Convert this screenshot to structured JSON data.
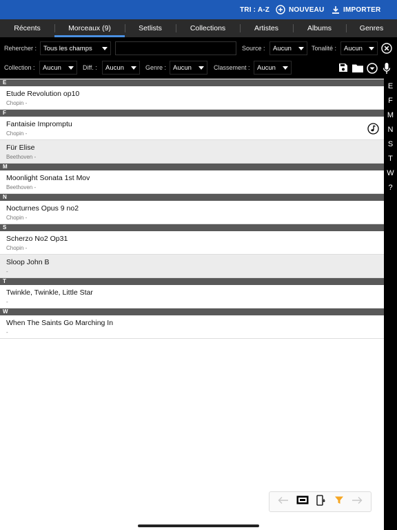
{
  "topbar": {
    "sort_label": "TRI : A-Z",
    "new_label": "NOUVEAU",
    "import_label": "IMPORTER",
    "bg_color": "#1e5bb8"
  },
  "tabs": [
    {
      "label": "Récents",
      "active": false
    },
    {
      "label": "Morceaux (9)",
      "active": true
    },
    {
      "label": "Setlists",
      "active": false
    },
    {
      "label": "Collections",
      "active": false
    },
    {
      "label": "Artistes",
      "active": false
    },
    {
      "label": "Albums",
      "active": false
    },
    {
      "label": "Genres",
      "active": false
    }
  ],
  "filters": {
    "search_label": "Rehercher :",
    "search_scope": "Tous les champs",
    "search_value": "",
    "source_label": "Source :",
    "source_value": "Aucun",
    "key_label": "Tonalité :",
    "key_value": "Aucun",
    "collection_label": "Collection :",
    "collection_value": "Aucun",
    "difficulty_label": "Diff. :",
    "difficulty_value": "Aucun",
    "genre_label": "Genre :",
    "genre_value": "Aucun",
    "rating_label": "Classement :",
    "rating_value": "Aucun"
  },
  "sections": [
    {
      "letter": "E",
      "items": [
        {
          "title": "Etude Revolution op10",
          "subtitle": "Chopin -",
          "alt": false,
          "note": false
        }
      ]
    },
    {
      "letter": "F",
      "items": [
        {
          "title": "Fantaisie Impromptu",
          "subtitle": "Chopin -",
          "alt": false,
          "note": true
        },
        {
          "title": "Für Elise",
          "subtitle": "Beethoven -",
          "alt": true,
          "note": false
        }
      ]
    },
    {
      "letter": "M",
      "items": [
        {
          "title": "Moonlight Sonata 1st Mov",
          "subtitle": "Beethoven -",
          "alt": false,
          "note": false
        }
      ]
    },
    {
      "letter": "N",
      "items": [
        {
          "title": "Nocturnes Opus 9 no2",
          "subtitle": "Chopin -",
          "alt": false,
          "note": false
        }
      ]
    },
    {
      "letter": "S",
      "items": [
        {
          "title": "Scherzo No2 Op31",
          "subtitle": "Chopin -",
          "alt": false,
          "note": false
        },
        {
          "title": "Sloop John B",
          "subtitle": " -",
          "alt": true,
          "note": false
        }
      ]
    },
    {
      "letter": "T",
      "items": [
        {
          "title": "Twinkle, Twinkle, Little Star",
          "subtitle": " -",
          "alt": false,
          "note": false
        }
      ]
    },
    {
      "letter": "W",
      "items": [
        {
          "title": "When The Saints Go Marching In",
          "subtitle": " -",
          "alt": false,
          "note": false
        }
      ]
    }
  ],
  "index_letters": [
    "E",
    "F",
    "M",
    "N",
    "S",
    "T",
    "W",
    "?"
  ],
  "icons": {
    "new": "plus-circle-icon",
    "import": "download-icon",
    "clear": "close-circle-icon",
    "save": "save-icon",
    "folder": "folder-icon",
    "dropdown": "chevron-down-circle-icon",
    "mic": "microphone-icon",
    "note": "music-note-icon"
  },
  "bottom_actions": [
    "arrow-left-icon",
    "screen-capture-icon",
    "device-rotate-icon",
    "filter-icon",
    "arrow-right-icon"
  ]
}
